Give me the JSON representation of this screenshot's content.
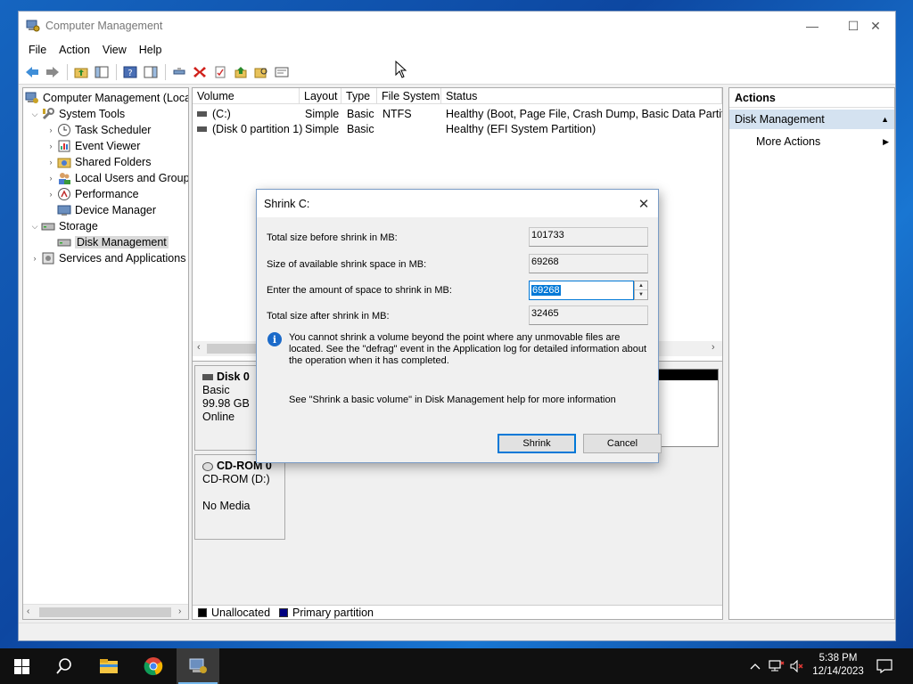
{
  "window": {
    "title": "Computer Management",
    "minimize_glyph": "—",
    "maximize_glyph": "☐",
    "close_glyph": "✕"
  },
  "menu": [
    "File",
    "Action",
    "View",
    "Help"
  ],
  "tree": {
    "root": "Computer Management (Local",
    "items": [
      {
        "label": "System Tools",
        "level": 1,
        "icon": "tools-icon"
      },
      {
        "label": "Task Scheduler",
        "level": 2,
        "icon": "clock-icon"
      },
      {
        "label": "Event Viewer",
        "level": 2,
        "icon": "event-viewer-icon"
      },
      {
        "label": "Shared Folders",
        "level": 2,
        "icon": "shared-folder-icon"
      },
      {
        "label": "Local Users and Groups",
        "level": 2,
        "icon": "users-icon"
      },
      {
        "label": "Performance",
        "level": 2,
        "icon": "performance-icon"
      },
      {
        "label": "Device Manager",
        "level": 2,
        "icon": "device-manager-icon"
      },
      {
        "label": "Storage",
        "level": 1,
        "icon": "storage-icon"
      },
      {
        "label": "Disk Management",
        "level": 2,
        "icon": "disk-icon",
        "selected": true
      },
      {
        "label": "Services and Applications",
        "level": 1,
        "icon": "services-icon"
      }
    ]
  },
  "volumes": {
    "columns": [
      "Volume",
      "Layout",
      "Type",
      "File System",
      "Status"
    ],
    "rows": [
      {
        "volume": "(C:)",
        "layout": "Simple",
        "type": "Basic",
        "fs": "NTFS",
        "status": "Healthy (Boot, Page File, Crash Dump, Basic Data Partition)"
      },
      {
        "volume": "(Disk 0 partition 1)",
        "layout": "Simple",
        "type": "Basic",
        "fs": "",
        "status": "Healthy (EFI System Partition)"
      }
    ]
  },
  "disks": [
    {
      "name": "Disk 0",
      "type": "Basic",
      "size": "99.98 GB",
      "state": "Online"
    },
    {
      "name": "CD-ROM 0",
      "type": "CD-ROM (D:)",
      "size": "",
      "state": "No Media"
    }
  ],
  "legend": [
    {
      "label": "Unallocated",
      "color": "#000000"
    },
    {
      "label": "Primary partition",
      "color": "#000080"
    }
  ],
  "actions": {
    "title": "Actions",
    "section": "Disk Management",
    "item": "More Actions"
  },
  "dialog": {
    "title": "Shrink C:",
    "total_before_label": "Total size before shrink in MB:",
    "total_before_value": "101733",
    "available_label": "Size of available shrink space in MB:",
    "available_value": "69268",
    "amount_label": "Enter the amount of space to shrink in MB:",
    "amount_value": "69268",
    "after_label": "Total size after shrink in MB:",
    "after_value": "32465",
    "info": "You cannot shrink a volume beyond the point where any unmovable files are located. See the \"defrag\" event in the Application log for detailed information about the operation when it has completed.",
    "help": "See \"Shrink a basic volume\" in Disk Management help for more information",
    "shrink_label": "Shrink",
    "cancel_label": "Cancel"
  },
  "taskbar": {
    "time": "5:38 PM",
    "date": "12/14/2023"
  },
  "colors": {
    "accent": "#0078d7",
    "selection": "#d4e2f0"
  }
}
